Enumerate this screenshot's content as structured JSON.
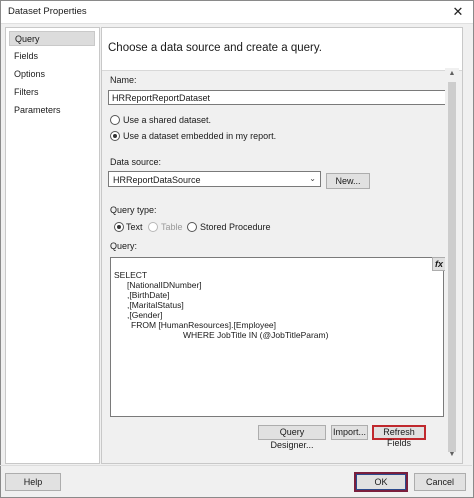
{
  "window": {
    "title": "Dataset Properties",
    "close_glyph": "✕"
  },
  "sidebar": {
    "items": [
      {
        "label": "Query",
        "selected": true
      },
      {
        "label": "Fields",
        "selected": false
      },
      {
        "label": "Options",
        "selected": false
      },
      {
        "label": "Filters",
        "selected": false
      },
      {
        "label": "Parameters",
        "selected": false
      }
    ]
  },
  "header": {
    "text": "Choose a data source and create a query."
  },
  "form": {
    "name_label": "Name:",
    "name_value": "HRReportReportDataset",
    "radio_shared": "Use a shared dataset.",
    "radio_embedded": "Use a dataset embedded in my report.",
    "datasource_label": "Data source:",
    "datasource_value": "HRReportDataSource",
    "new_button": "New...",
    "querytype_label": "Query type:",
    "qt_text": "Text",
    "qt_table": "Table",
    "qt_stored": "Stored Procedure",
    "query_label": "Query:",
    "fx_label": "fx",
    "query_lines": [
      "SELECT",
      "[NationalIDNumber]",
      ",[BirthDate]",
      ",[MaritalStatus]",
      ",[Gender]",
      "FROM [HumanResources].[Employee]",
      "WHERE JobTitle IN (@JobTitleParam)"
    ],
    "query_designer_button": "Query Designer...",
    "import_button": "Import...",
    "refresh_button": "Refresh Fields"
  },
  "footer": {
    "help": "Help",
    "ok": "OK",
    "cancel": "Cancel"
  },
  "colors": {
    "highlight_border": "#c0282d",
    "selected_nav": "#dcdcdc"
  }
}
